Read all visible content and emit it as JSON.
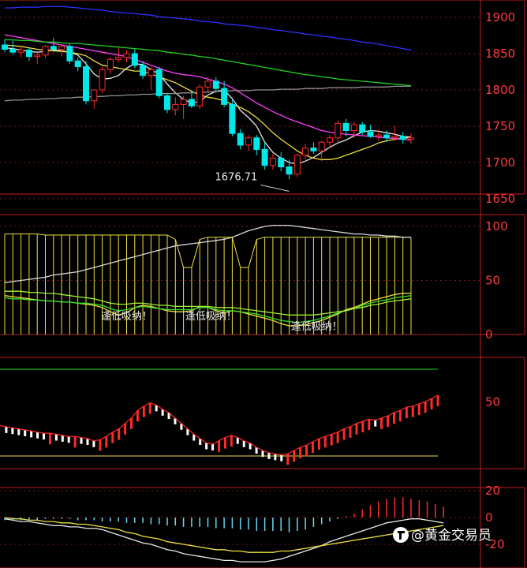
{
  "watermark": {
    "text": "@黄金交易员",
    "icon": "toutiao-logo"
  },
  "colors": {
    "up": "#ff2a2a",
    "down": "#00e8e8",
    "axis": "#c81e1e",
    "ma5": "#e8e8e8",
    "ma10": "#f0e040",
    "ma20": "#ff40ff",
    "ma60": "#20d020",
    "ma120": "#3030ff",
    "ma250": "#909090",
    "kdj_bar": "#f0e040",
    "macd_pos": "#ff2a2a",
    "macd_neg": "#6ad8f0"
  },
  "chart_data": [
    {
      "type": "candlestick",
      "panel": "price",
      "ylim": [
        1650,
        1920
      ],
      "yticks": [
        "1900",
        "1850",
        "1800",
        "1750",
        "1700",
        "1650"
      ],
      "annotation": {
        "text": "1676.71",
        "value": 1676.71
      },
      "candles": [
        [
          1862,
          1870,
          1852,
          1856
        ],
        [
          1856,
          1868,
          1848,
          1852
        ],
        [
          1852,
          1860,
          1845,
          1855
        ],
        [
          1855,
          1858,
          1840,
          1846
        ],
        [
          1846,
          1852,
          1836,
          1848
        ],
        [
          1848,
          1862,
          1844,
          1860
        ],
        [
          1860,
          1872,
          1852,
          1856
        ],
        [
          1856,
          1862,
          1846,
          1860
        ],
        [
          1860,
          1864,
          1836,
          1840
        ],
        [
          1840,
          1845,
          1826,
          1832
        ],
        [
          1832,
          1840,
          1780,
          1785
        ],
        [
          1785,
          1790,
          1774,
          1800
        ],
        [
          1800,
          1832,
          1796,
          1828
        ],
        [
          1828,
          1845,
          1822,
          1842
        ],
        [
          1842,
          1858,
          1838,
          1845
        ],
        [
          1845,
          1855,
          1838,
          1850
        ],
        [
          1850,
          1856,
          1830,
          1834
        ],
        [
          1834,
          1840,
          1815,
          1820
        ],
        [
          1820,
          1832,
          1800,
          1828
        ],
        [
          1828,
          1832,
          1788,
          1792
        ],
        [
          1792,
          1796,
          1768,
          1773
        ],
        [
          1773,
          1790,
          1765,
          1780
        ],
        [
          1780,
          1792,
          1760,
          1787
        ],
        [
          1787,
          1800,
          1775,
          1778
        ],
        [
          1778,
          1808,
          1774,
          1804
        ],
        [
          1804,
          1818,
          1798,
          1812
        ],
        [
          1812,
          1818,
          1796,
          1802
        ],
        [
          1802,
          1812,
          1776,
          1780
        ],
        [
          1780,
          1786,
          1736,
          1740
        ],
        [
          1740,
          1746,
          1718,
          1724
        ],
        [
          1724,
          1738,
          1716,
          1734
        ],
        [
          1734,
          1738,
          1710,
          1718
        ],
        [
          1718,
          1728,
          1690,
          1696
        ],
        [
          1696,
          1712,
          1690,
          1706
        ],
        [
          1706,
          1714,
          1688,
          1694
        ],
        [
          1694,
          1704,
          1676.71,
          1684
        ],
        [
          1684,
          1712,
          1680,
          1710
        ],
        [
          1710,
          1726,
          1704,
          1720
        ],
        [
          1720,
          1728,
          1712,
          1716
        ],
        [
          1716,
          1730,
          1702,
          1728
        ],
        [
          1728,
          1738,
          1720,
          1734
        ],
        [
          1734,
          1758,
          1728,
          1754
        ],
        [
          1754,
          1760,
          1736,
          1744
        ],
        [
          1744,
          1756,
          1734,
          1752
        ],
        [
          1752,
          1756,
          1738,
          1742
        ],
        [
          1742,
          1752,
          1734,
          1736
        ],
        [
          1736,
          1746,
          1730,
          1738
        ],
        [
          1738,
          1744,
          1728,
          1734
        ],
        [
          1734,
          1750,
          1730,
          1736
        ],
        [
          1736,
          1742,
          1726,
          1732
        ],
        [
          1732,
          1740,
          1726,
          1734
        ]
      ],
      "ma": {
        "ma5": [
          1858,
          1857,
          1855,
          1853,
          1852,
          1853,
          1855,
          1854,
          1852,
          1848,
          1836,
          1822,
          1815,
          1816,
          1820,
          1830,
          1836,
          1835,
          1828,
          1822,
          1808,
          1796,
          1787,
          1782,
          1784,
          1793,
          1798,
          1800,
          1788,
          1772,
          1762,
          1750,
          1728,
          1714,
          1706,
          1700,
          1698,
          1702,
          1707,
          1714,
          1721,
          1727,
          1731,
          1737,
          1742,
          1744,
          1743,
          1741,
          1739,
          1736,
          1735
        ],
        "ma10": [
          1862,
          1861,
          1860,
          1858,
          1856,
          1855,
          1854,
          1853,
          1852,
          1850,
          1847,
          1840,
          1834,
          1832,
          1830,
          1828,
          1826,
          1826,
          1822,
          1818,
          1814,
          1810,
          1804,
          1798,
          1793,
          1790,
          1788,
          1785,
          1780,
          1776,
          1770,
          1762,
          1752,
          1741,
          1732,
          1724,
          1716,
          1710,
          1706,
          1704,
          1704,
          1706,
          1710,
          1714,
          1718,
          1722,
          1727,
          1730,
          1732,
          1734,
          1734
        ],
        "ma20": [
          1876,
          1874,
          1872,
          1870,
          1868,
          1866,
          1864,
          1862,
          1860,
          1858,
          1856,
          1854,
          1852,
          1850,
          1848,
          1846,
          1842,
          1838,
          1834,
          1830,
          1826,
          1823,
          1821,
          1820,
          1818,
          1815,
          1812,
          1808,
          1803,
          1796,
          1789,
          1782,
          1776,
          1770,
          1765,
          1760,
          1756,
          1752,
          1748,
          1744,
          1742,
          1740,
          1739,
          1738,
          1737,
          1736,
          1735,
          1734,
          1733,
          1732,
          1731
        ],
        "ma60": [
          1869,
          1869,
          1868,
          1868,
          1867,
          1866,
          1866,
          1865,
          1864,
          1864,
          1863,
          1862,
          1861,
          1860,
          1859,
          1858,
          1857,
          1856,
          1855,
          1854,
          1852,
          1851,
          1849,
          1848,
          1846,
          1845,
          1843,
          1841,
          1839,
          1837,
          1835,
          1833,
          1831,
          1829,
          1827,
          1825,
          1823,
          1821,
          1820,
          1818,
          1817,
          1815,
          1814,
          1813,
          1812,
          1811,
          1810,
          1809,
          1808,
          1807,
          1806
        ],
        "ma120": [
          1913,
          1913,
          1914,
          1914,
          1914,
          1915,
          1915,
          1915,
          1914,
          1913,
          1912,
          1911,
          1910,
          1908,
          1907,
          1906,
          1905,
          1904,
          1903,
          1901,
          1900,
          1899,
          1898,
          1897,
          1895,
          1894,
          1893,
          1891,
          1890,
          1889,
          1888,
          1886,
          1885,
          1883,
          1882,
          1880,
          1879,
          1877,
          1876,
          1874,
          1873,
          1871,
          1870,
          1868,
          1866,
          1865,
          1863,
          1861,
          1859,
          1857,
          1855
        ],
        "ma250": [
          1785,
          1786,
          1786,
          1787,
          1787,
          1788,
          1788,
          1789,
          1789,
          1790,
          1790,
          1791,
          1791,
          1792,
          1792,
          1793,
          1793,
          1794,
          1794,
          1795,
          1795,
          1795,
          1796,
          1796,
          1797,
          1797,
          1798,
          1798,
          1799,
          1799,
          1799,
          1800,
          1800,
          1800,
          1801,
          1801,
          1801,
          1802,
          1802,
          1802,
          1803,
          1803,
          1803,
          1803,
          1804,
          1804,
          1804,
          1804,
          1805,
          1805,
          1805
        ]
      }
    },
    {
      "type": "line",
      "panel": "indicator",
      "ylim": [
        0,
        100
      ],
      "yticks": [
        "100",
        "50",
        "0"
      ],
      "annotations": [
        {
          "text": "逢低吸纳！",
          "x_index": 13
        },
        {
          "text": "逢低吸纳！",
          "x_index": 23
        },
        {
          "text": "逢低吸纳！",
          "x_index": 36
        }
      ],
      "bar_top": [
        93,
        93,
        93,
        93,
        93,
        92,
        92,
        92,
        92,
        92,
        92,
        92,
        92,
        92,
        92,
        92,
        92,
        92,
        92,
        92,
        92,
        88,
        62,
        62,
        88,
        90,
        90,
        90,
        90,
        62,
        62,
        88,
        90,
        90,
        90,
        90,
        90,
        90,
        90,
        90,
        90,
        90,
        90,
        90,
        90,
        90,
        90,
        90,
        90,
        90,
        90
      ],
      "series": [
        {
          "values": [
            48,
            49,
            50,
            51,
            52,
            53,
            55,
            56,
            57,
            58,
            60,
            62,
            64,
            66,
            68,
            70,
            72,
            74,
            76,
            78,
            80,
            82,
            83,
            84,
            85,
            86,
            87,
            88,
            90,
            93,
            96,
            98,
            100,
            101,
            101,
            101,
            100,
            99,
            98,
            97,
            96,
            95,
            94,
            93,
            93,
            92,
            92,
            91,
            91,
            90,
            90
          ]
        },
        {
          "values": [
            36,
            35,
            34,
            33,
            32,
            31,
            31,
            30,
            30,
            29,
            28,
            27,
            25,
            21,
            18,
            20,
            25,
            27,
            26,
            24,
            22,
            21,
            21,
            22,
            26,
            25,
            22,
            20,
            22,
            21,
            19,
            17,
            15,
            13,
            10,
            8,
            8,
            9,
            11,
            13,
            16,
            19,
            23,
            25,
            28,
            31,
            33,
            35,
            37,
            38,
            38
          ]
        },
        {
          "values": [
            34,
            33,
            33,
            32,
            32,
            31,
            31,
            30,
            30,
            29,
            29,
            28,
            27,
            24,
            22,
            23,
            25,
            26,
            25,
            24,
            23,
            23,
            23,
            23,
            25,
            25,
            23,
            22,
            22,
            21,
            20,
            19,
            17,
            15,
            13,
            12,
            11,
            12,
            13,
            15,
            17,
            20,
            22,
            24,
            27,
            29,
            31,
            32,
            34,
            35,
            36
          ]
        },
        {
          "values": [
            40,
            40,
            40,
            39,
            39,
            38,
            38,
            37,
            36,
            35,
            34,
            33,
            31,
            29,
            28,
            28,
            29,
            29,
            28,
            27,
            27,
            26,
            26,
            26,
            26,
            26,
            25,
            25,
            25,
            24,
            23,
            22,
            21,
            20,
            19,
            18,
            18,
            18,
            18,
            19,
            20,
            21,
            22,
            24,
            25,
            27,
            28,
            30,
            31,
            32,
            33
          ]
        }
      ]
    },
    {
      "type": "line",
      "panel": "oscillator",
      "ylim": [
        0,
        80
      ],
      "yticks": [
        "50"
      ],
      "levels": [
        80,
        0
      ],
      "values": [
        28,
        27,
        26,
        25,
        24,
        23,
        22,
        21,
        21,
        20,
        19,
        18,
        18,
        17,
        16,
        14,
        15,
        18,
        22,
        25,
        30,
        35,
        42,
        46,
        49,
        47,
        43,
        40,
        35,
        30,
        25,
        20,
        16,
        12,
        11,
        14,
        17,
        19,
        17,
        14,
        12,
        8,
        5,
        3,
        2,
        1,
        2,
        5,
        8,
        10,
        13,
        16,
        18,
        20,
        22,
        25,
        27,
        30,
        32,
        34,
        33,
        35,
        37,
        40,
        42,
        45,
        46,
        48,
        50,
        53,
        56
      ]
    },
    {
      "type": "bar",
      "panel": "macd",
      "ylim": [
        -25,
        25
      ],
      "yticks": [
        "20",
        "0",
        "-20"
      ],
      "values": [
        -2,
        -2,
        -2,
        -2,
        -2,
        -1,
        -1,
        -1,
        -1,
        -2,
        -2,
        -2,
        -3,
        -3,
        -3,
        -4,
        -4,
        -4,
        -5,
        -5,
        -6,
        -6,
        -7,
        -7,
        -7,
        -7,
        -8,
        -8,
        -8,
        -9,
        -9,
        -10,
        -10,
        -10,
        -10,
        -11,
        -10,
        -9,
        -7,
        -5,
        -3,
        -1,
        1,
        3,
        6,
        9,
        12,
        14,
        15,
        15,
        14,
        13,
        12,
        10,
        8
      ],
      "dif": [
        -1,
        -2,
        -3,
        -3,
        -4,
        -5,
        -6,
        -6,
        -7,
        -7,
        -8,
        -8,
        -9,
        -11,
        -13,
        -15,
        -17,
        -19,
        -20,
        -22,
        -24,
        -25,
        -27,
        -28,
        -29,
        -30,
        -31,
        -32,
        -32,
        -33,
        -33,
        -33,
        -33,
        -32,
        -31,
        -29,
        -27,
        -25,
        -23,
        -21,
        -18,
        -16,
        -14,
        -12,
        -10,
        -8,
        -6,
        -4,
        -3,
        -2,
        -1,
        -1,
        -2,
        -3,
        -4
      ],
      "dea": [
        0,
        -1,
        -1,
        -2,
        -2,
        -3,
        -3,
        -4,
        -4,
        -5,
        -5,
        -6,
        -7,
        -8,
        -9,
        -11,
        -12,
        -14,
        -15,
        -16,
        -18,
        -19,
        -20,
        -21,
        -22,
        -23,
        -24,
        -24,
        -25,
        -25,
        -26,
        -26,
        -26,
        -26,
        -25,
        -25,
        -24,
        -23,
        -22,
        -21,
        -20,
        -19,
        -18,
        -17,
        -16,
        -15,
        -14,
        -13,
        -12,
        -11,
        -10,
        -9,
        -8,
        -7,
        -6
      ]
    }
  ]
}
